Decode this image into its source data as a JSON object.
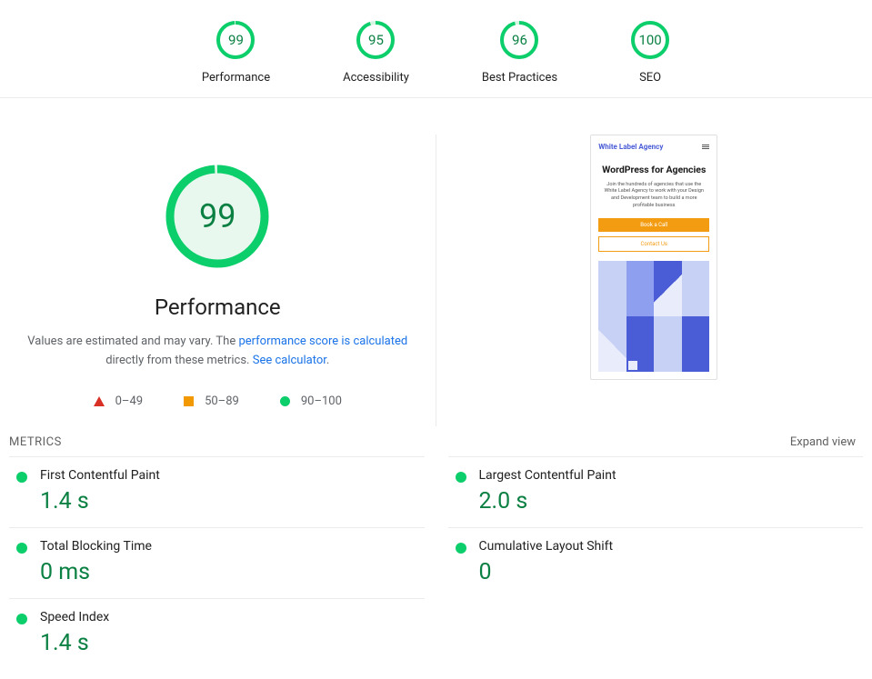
{
  "gauges": [
    {
      "label": "Performance",
      "score": 99
    },
    {
      "label": "Accessibility",
      "score": 95
    },
    {
      "label": "Best Practices",
      "score": 96
    },
    {
      "label": "SEO",
      "score": 100
    }
  ],
  "main": {
    "score": 99,
    "title": "Performance",
    "desc_prefix": "Values are estimated and may vary. The ",
    "link1": "performance score is calculated",
    "desc_mid": " directly from these metrics. ",
    "link2": "See calculator",
    "desc_suffix": "."
  },
  "legend": {
    "poor": "0–49",
    "avg": "50–89",
    "good": "90–100"
  },
  "thumbnail": {
    "logo": "White Label Agency",
    "title": "WordPress for Agencies",
    "subtitle": "Join the hundreds of agencies that use the White Label Agency to work with your Design and Development team to build a more profitable business",
    "btn_primary": "Book a Call",
    "btn_secondary": "Contact Us"
  },
  "metrics_header": "METRICS",
  "expand_label": "Expand view",
  "metrics": [
    {
      "name": "First Contentful Paint",
      "value": "1.4 s",
      "status": "good"
    },
    {
      "name": "Largest Contentful Paint",
      "value": "2.0 s",
      "status": "good"
    },
    {
      "name": "Total Blocking Time",
      "value": "0 ms",
      "status": "good"
    },
    {
      "name": "Cumulative Layout Shift",
      "value": "0",
      "status": "good"
    },
    {
      "name": "Speed Index",
      "value": "1.4 s",
      "status": "good"
    }
  ],
  "colors": {
    "good": "#0cce6b",
    "good_text": "#0b8043",
    "avg": "#f29900",
    "poor": "#d93025",
    "track": "#d6f5e2"
  }
}
